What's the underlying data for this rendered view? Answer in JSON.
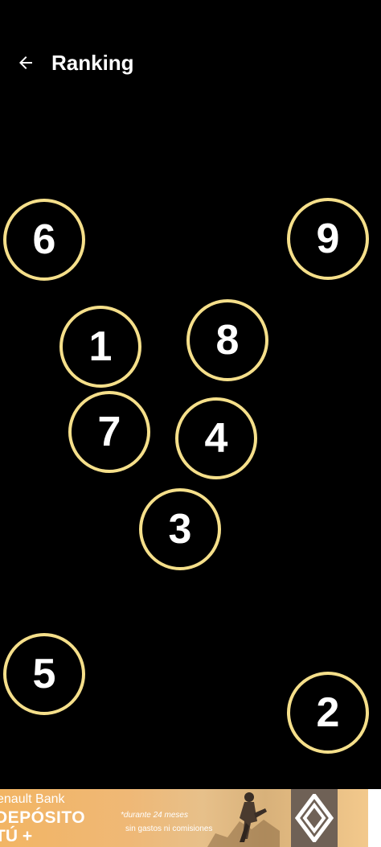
{
  "header": {
    "title": "Ranking",
    "back_icon": "arrow-left-icon"
  },
  "rankings": [
    {
      "number": "6"
    },
    {
      "number": "9"
    },
    {
      "number": "1"
    },
    {
      "number": "8"
    },
    {
      "number": "7"
    },
    {
      "number": "4"
    },
    {
      "number": "3"
    },
    {
      "number": "5"
    },
    {
      "number": "2"
    }
  ],
  "ad": {
    "brand": "enault Bank",
    "headline_line1": "DEPÓSITO",
    "headline_line2": "TÚ +",
    "note_line1": "*durante 24 meses",
    "note_line2": "sin gastos ni comisiones",
    "logo_icon": "renault-logo-icon"
  },
  "colors": {
    "background": "#000000",
    "ring": "#f5df8a",
    "text": "#ffffff"
  }
}
